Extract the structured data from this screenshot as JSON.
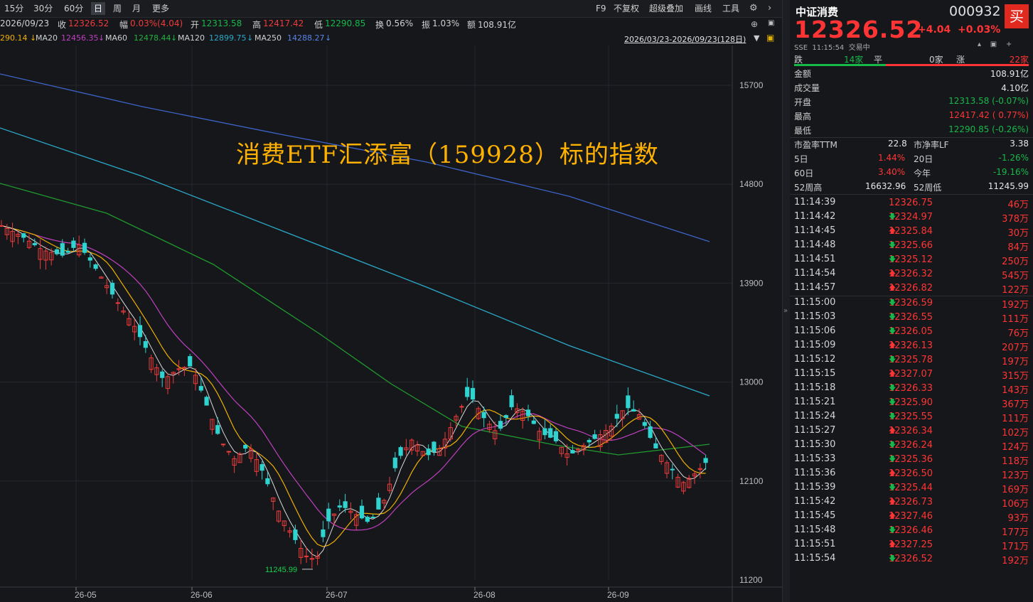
{
  "toolbar": {
    "periods": [
      "15分",
      "30分",
      "60分",
      "日",
      "周",
      "月",
      "更多"
    ],
    "active_period": "日",
    "tools": [
      "F9",
      "不复权",
      "超级叠加",
      "画线",
      "工具"
    ]
  },
  "info": {
    "date": "2026/09/23",
    "close_label": "收",
    "close": "12326.52",
    "change_label": "幅",
    "change": "0.03%(4.04)",
    "open_label": "开",
    "open": "12313.58",
    "high_label": "高",
    "high": "12417.42",
    "low_label": "低",
    "low": "12290.85",
    "turnover_label": "换",
    "turnover": "0.56%",
    "amplitude_label": "振",
    "amplitude": "1.03%",
    "amount_label": "额",
    "amount": "108.91亿"
  },
  "ma_line": {
    "ma10_value": "290.14",
    "ma20_label": "MA20",
    "ma20_value": "12456.35",
    "ma60_label": "MA60",
    "ma60_value": "12478.44",
    "ma120_label": "MA120",
    "ma120_value": "12899.75",
    "ma250_label": "MA250",
    "ma250_value": "14288.27",
    "range": "2026/03/23-2026/09/23(128日)"
  },
  "overlay_title": "消费ETF汇添富（159928）标的指数",
  "chart_data": {
    "type": "candlestick",
    "y_ticks": [
      15700,
      14800,
      13900,
      13000,
      12100,
      11200
    ],
    "x_ticks": [
      "26-05",
      "26-06",
      "26-07",
      "26-08",
      "26-09"
    ],
    "ylim": [
      11200,
      15700
    ],
    "min_label": "11245.99",
    "moving_averages": [
      "MA5",
      "MA10",
      "MA20",
      "MA60",
      "MA120",
      "MA250"
    ],
    "colors": {
      "up": "#ee3b3b",
      "down": "#2fd3cf",
      "ma5": "#d9d9d9",
      "ma10": "#f0b000",
      "ma20": "#c040c0",
      "ma60": "#1f9a2f",
      "ma120": "#2aa9c9",
      "ma250": "#3c64c8"
    }
  },
  "panel": {
    "name": "中证消费",
    "code": "000932",
    "buy_label": "买",
    "price": "12326.52",
    "change": "+4.04",
    "change_pct": "+0.03%",
    "exchange": "SSE",
    "time": "11:15:54",
    "status": "交易中",
    "breadth": {
      "down_label": "跌",
      "down": "14家",
      "flat_label": "平",
      "flat": "0家",
      "up_label": "涨",
      "up": "22家"
    },
    "stats": [
      {
        "label": "金额",
        "value": "108.91亿"
      },
      {
        "label": "成交量",
        "value": "4.10亿"
      },
      {
        "label": "开盘",
        "value": "12313.58 (-0.07%)"
      },
      {
        "label": "最高",
        "value": "12417.42 ( 0.77%)"
      },
      {
        "label": "最低",
        "value": "12290.85 (-0.26%)"
      }
    ],
    "ratios": [
      {
        "l1": "市盈率TTM",
        "v1": "22.8",
        "l2": "市净率LF",
        "v2": "3.38"
      },
      {
        "l1": "5日",
        "v1": "1.44%",
        "l2": "20日",
        "v2": "-1.26%"
      },
      {
        "l1": "60日",
        "v1": "3.40%",
        "l2": "今年",
        "v2": "-19.16%"
      },
      {
        "l1": "52周高",
        "v1": "16632.96",
        "l2": "52周低",
        "v2": "11245.99"
      }
    ],
    "ticks": [
      {
        "time": "11:14:39",
        "price": "12326.75",
        "dir": "",
        "vol": "46万"
      },
      {
        "time": "11:14:42",
        "price": "12324.97",
        "dir": "down",
        "vol": "378万"
      },
      {
        "time": "11:14:45",
        "price": "12325.84",
        "dir": "up",
        "vol": "30万"
      },
      {
        "time": "11:14:48",
        "price": "12325.66",
        "dir": "down",
        "vol": "84万"
      },
      {
        "time": "11:14:51",
        "price": "12325.12",
        "dir": "down",
        "vol": "250万"
      },
      {
        "time": "11:14:54",
        "price": "12326.32",
        "dir": "up",
        "vol": "545万"
      },
      {
        "time": "11:14:57",
        "price": "12326.82",
        "dir": "up",
        "vol": "122万"
      },
      {
        "time": "11:15:00",
        "price": "12326.59",
        "dir": "down",
        "vol": "192万"
      },
      {
        "time": "11:15:03",
        "price": "12326.55",
        "dir": "down",
        "vol": "111万"
      },
      {
        "time": "11:15:06",
        "price": "12326.05",
        "dir": "down",
        "vol": "76万"
      },
      {
        "time": "11:15:09",
        "price": "12326.13",
        "dir": "up",
        "vol": "207万"
      },
      {
        "time": "11:15:12",
        "price": "12325.78",
        "dir": "down",
        "vol": "197万"
      },
      {
        "time": "11:15:15",
        "price": "12327.07",
        "dir": "up",
        "vol": "315万"
      },
      {
        "time": "11:15:18",
        "price": "12326.33",
        "dir": "down",
        "vol": "143万"
      },
      {
        "time": "11:15:21",
        "price": "12325.90",
        "dir": "down",
        "vol": "367万"
      },
      {
        "time": "11:15:24",
        "price": "12325.55",
        "dir": "down",
        "vol": "111万"
      },
      {
        "time": "11:15:27",
        "price": "12326.34",
        "dir": "up",
        "vol": "102万"
      },
      {
        "time": "11:15:30",
        "price": "12326.24",
        "dir": "down",
        "vol": "124万"
      },
      {
        "time": "11:15:33",
        "price": "12325.36",
        "dir": "down",
        "vol": "118万"
      },
      {
        "time": "11:15:36",
        "price": "12326.50",
        "dir": "up",
        "vol": "123万"
      },
      {
        "time": "11:15:39",
        "price": "12325.44",
        "dir": "down",
        "vol": "169万"
      },
      {
        "time": "11:15:42",
        "price": "12326.73",
        "dir": "up",
        "vol": "106万"
      },
      {
        "time": "11:15:45",
        "price": "12327.46",
        "dir": "up",
        "vol": "93万"
      },
      {
        "time": "11:15:48",
        "price": "12326.46",
        "dir": "down",
        "vol": "177万"
      },
      {
        "time": "11:15:51",
        "price": "12327.25",
        "dir": "up",
        "vol": "171万"
      },
      {
        "time": "11:15:54",
        "price": "12326.52",
        "dir": "down",
        "vol": "192万"
      }
    ]
  }
}
